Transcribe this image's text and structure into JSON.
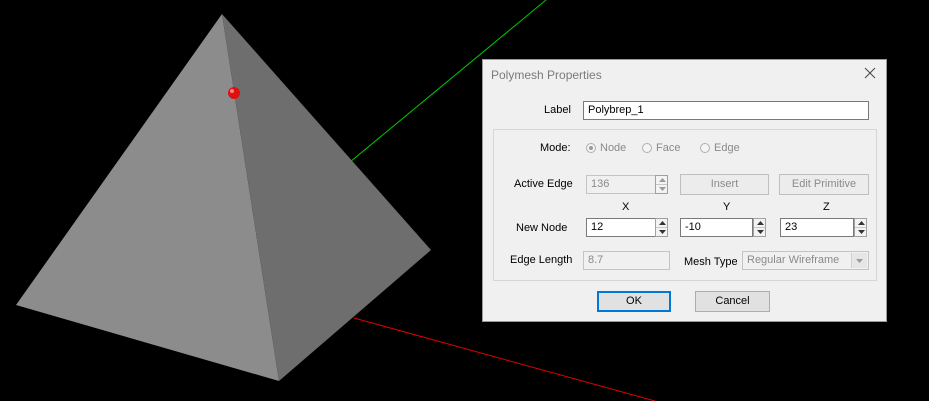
{
  "dialog": {
    "title": "Polymesh Properties",
    "label_caption": "Label",
    "label_value": "Polybrep_1",
    "mode_caption": "Mode:",
    "mode_options": [
      "Node",
      "Face",
      "Edge"
    ],
    "mode_selected": "Node",
    "active_edge_caption": "Active Edge",
    "active_edge_value": "136",
    "insert_button": "Insert",
    "edit_primitive_button": "Edit Primitive",
    "x_header": "X",
    "y_header": "Y",
    "z_header": "Z",
    "new_node_caption": "New Node",
    "new_node_x": "12",
    "new_node_y": "-10",
    "new_node_z": "23",
    "edge_length_caption": "Edge Length",
    "edge_length_value": "8.7",
    "mesh_type_caption": "Mesh Type",
    "mesh_type_value": "Regular Wireframe",
    "ok_button": "OK",
    "cancel_button": "Cancel"
  },
  "colors": {
    "background": "#000000",
    "pyramid_left_face": "#8c8c8c",
    "pyramid_right_face": "#6e6e6e",
    "node_marker": "#e01010",
    "axis_green": "#00c800",
    "axis_red": "#e00000"
  },
  "icons": {
    "close": "close-icon",
    "spin_up": "spin-up-icon",
    "spin_down": "spin-down-icon",
    "dropdown": "chevron-down-icon"
  }
}
